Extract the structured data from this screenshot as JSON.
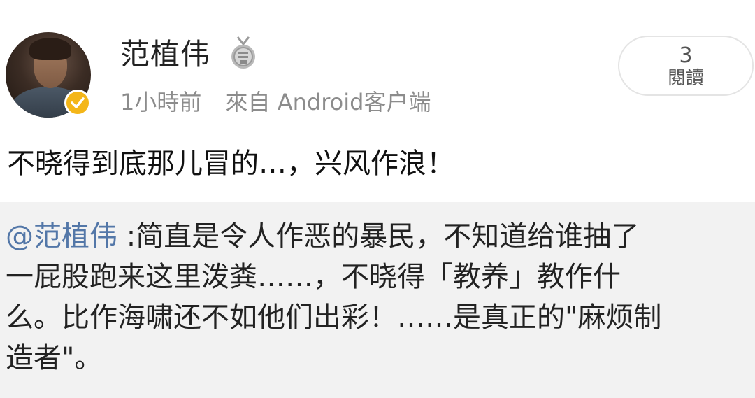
{
  "author": {
    "name": "范植伟",
    "time": "1小時前",
    "source": "來自 Android客户端"
  },
  "read_badge": {
    "count": "3",
    "label": "閱讀"
  },
  "post": {
    "text": "不晓得到底那儿冒的…，兴风作浪！"
  },
  "quoted": {
    "mention": "@范植伟",
    "line1": " :简直是令人作恶的暴民，不知道给谁抽了",
    "line2": "一屁股跑来这里泼粪……，不晓得「教养」教作什",
    "line3": "么。比作海啸还不如他们出彩！……是真正的\"麻烦制",
    "line4": "造者\"。"
  },
  "icons": {
    "avatar": "user-avatar",
    "verified": "verified-badge-icon",
    "medal": "medal-icon"
  },
  "colors": {
    "mention": "#5377a8",
    "quote_background": "#f2f2f2",
    "verified": "#f4b619",
    "meta_text": "#8c8c8c"
  }
}
